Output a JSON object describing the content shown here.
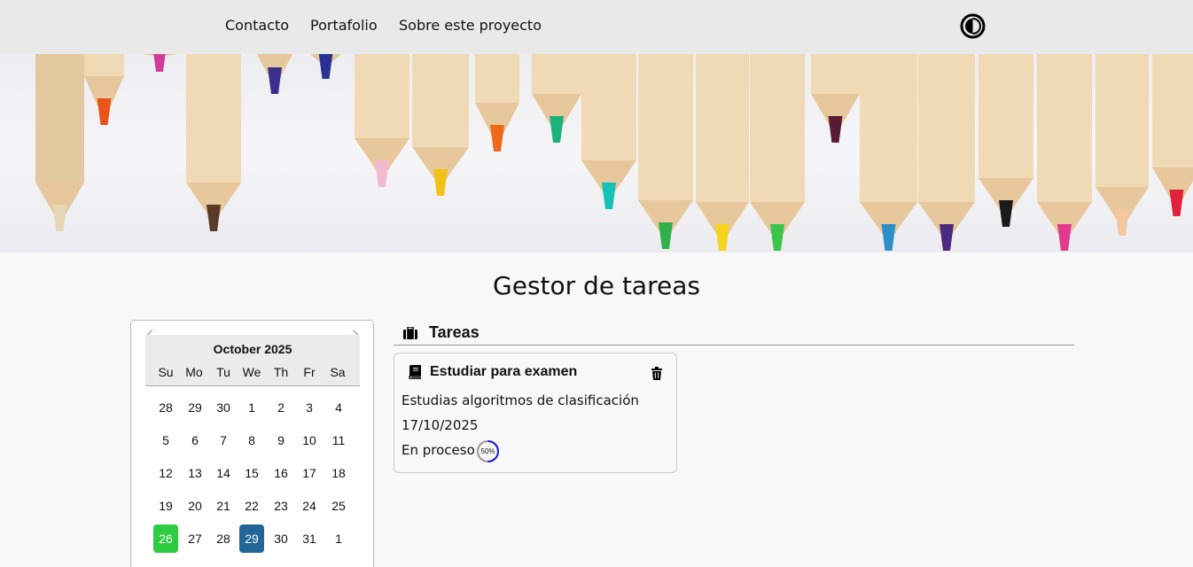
{
  "nav": {
    "links": [
      "Contacto",
      "Portafolio",
      "Sobre este proyecto"
    ],
    "theme_icon": "contrast-icon"
  },
  "page": {
    "title": "Gestor de tareas"
  },
  "calendar": {
    "month_label": "October 2025",
    "weekdays": [
      "Su",
      "Mo",
      "Tu",
      "We",
      "Th",
      "Fr",
      "Sa"
    ],
    "weeks": [
      [
        "28",
        "29",
        "30",
        "1",
        "2",
        "3",
        "4"
      ],
      [
        "5",
        "6",
        "7",
        "8",
        "9",
        "10",
        "11"
      ],
      [
        "12",
        "13",
        "14",
        "15",
        "16",
        "17",
        "18"
      ],
      [
        "19",
        "20",
        "21",
        "22",
        "23",
        "24",
        "25"
      ],
      [
        "26",
        "27",
        "28",
        "29",
        "30",
        "31",
        "1"
      ]
    ],
    "today": "26",
    "selected": "29",
    "colors": {
      "today": "#2ecc40",
      "selected": "#226699"
    }
  },
  "tasks": {
    "header": "Tareas",
    "items": [
      {
        "title": "Estudiar para examen",
        "description": "Estudias algoritmos de clasificación",
        "date": "17/10/2025",
        "status": "En proceso",
        "progress_label": "50%",
        "progress_fraction": 0.5,
        "progress_color": "#1a1adb"
      }
    ]
  }
}
